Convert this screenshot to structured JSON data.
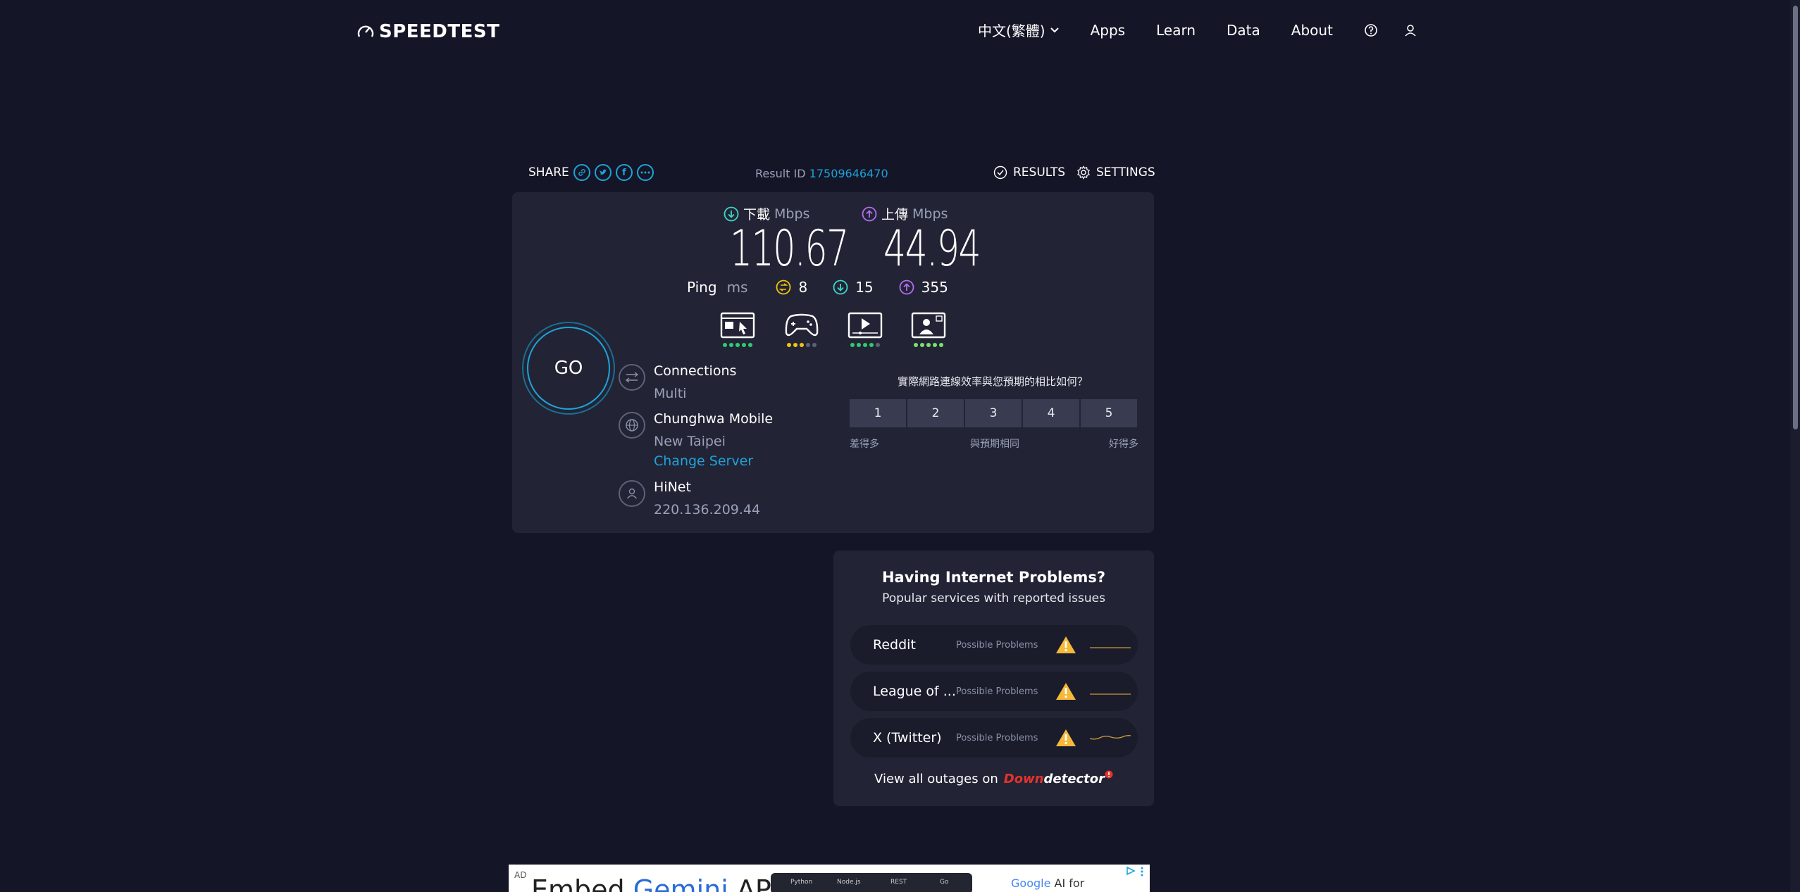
{
  "header": {
    "logo": "SPEEDTEST",
    "language": "中文(繁體)",
    "nav": [
      "Apps",
      "Learn",
      "Data",
      "About"
    ]
  },
  "share": {
    "label": "SHARE",
    "result_id_label": "Result ID",
    "result_id": "17509646470",
    "results_label": "RESULTS",
    "settings_label": "SETTINGS"
  },
  "metrics": {
    "download_label": "下載",
    "upload_label": "上傳",
    "unit": "Mbps",
    "download": "110.67",
    "upload": "44.94",
    "ping_label": "Ping",
    "ping_unit": "ms",
    "ping_idle": "8",
    "ping_download": "15",
    "ping_upload": "355"
  },
  "quality": [
    {
      "icon": "browsing-icon",
      "filled": 5,
      "color": "#2ecc71"
    },
    {
      "icon": "gaming-icon",
      "filled": 3,
      "color": "#f1c40f"
    },
    {
      "icon": "video-streaming-icon",
      "filled": 4,
      "color": "#2ecc71"
    },
    {
      "icon": "video-chat-icon",
      "filled": 5,
      "color": "#7ee06a"
    }
  ],
  "go_label": "GO",
  "connections": {
    "title": "Connections",
    "value": "Multi"
  },
  "server": {
    "name": "Chunghwa Mobile",
    "location": "New Taipei",
    "change_label": "Change Server"
  },
  "isp": {
    "name": "HiNet",
    "ip": "220.136.209.44"
  },
  "survey": {
    "question": "實際網路連線效率與您預期的相比如何？",
    "options": [
      "1",
      "2",
      "3",
      "4",
      "5"
    ],
    "low_label": "差得多",
    "mid_label": "與預期相同",
    "high_label": "好得多"
  },
  "downdetector": {
    "title": "Having Internet Problems?",
    "subtitle": "Popular services with reported issues",
    "services": [
      {
        "name": "Reddit",
        "status": "Possible Problems"
      },
      {
        "name": "League of ...",
        "status": "Possible Problems"
      },
      {
        "name": "X (Twitter)",
        "status": "Possible Problems"
      }
    ],
    "footer": "View all outages on",
    "brand_down": "Down",
    "brand_detector": "detector"
  },
  "ad": {
    "label": "AD",
    "headline_a": "Embed ",
    "headline_b": "Gemini",
    "headline_c": " API",
    "tabs": [
      "Python",
      "Node.js",
      "REST",
      "Go"
    ],
    "right_a": "Google",
    "right_b": " AI for Developers"
  },
  "colors": {
    "accent": "#1ea3d8",
    "download": "#3ed6c8",
    "upload": "#b46cf0",
    "warning": "#f5b93a",
    "background": "#141526",
    "panel": "#222435"
  }
}
